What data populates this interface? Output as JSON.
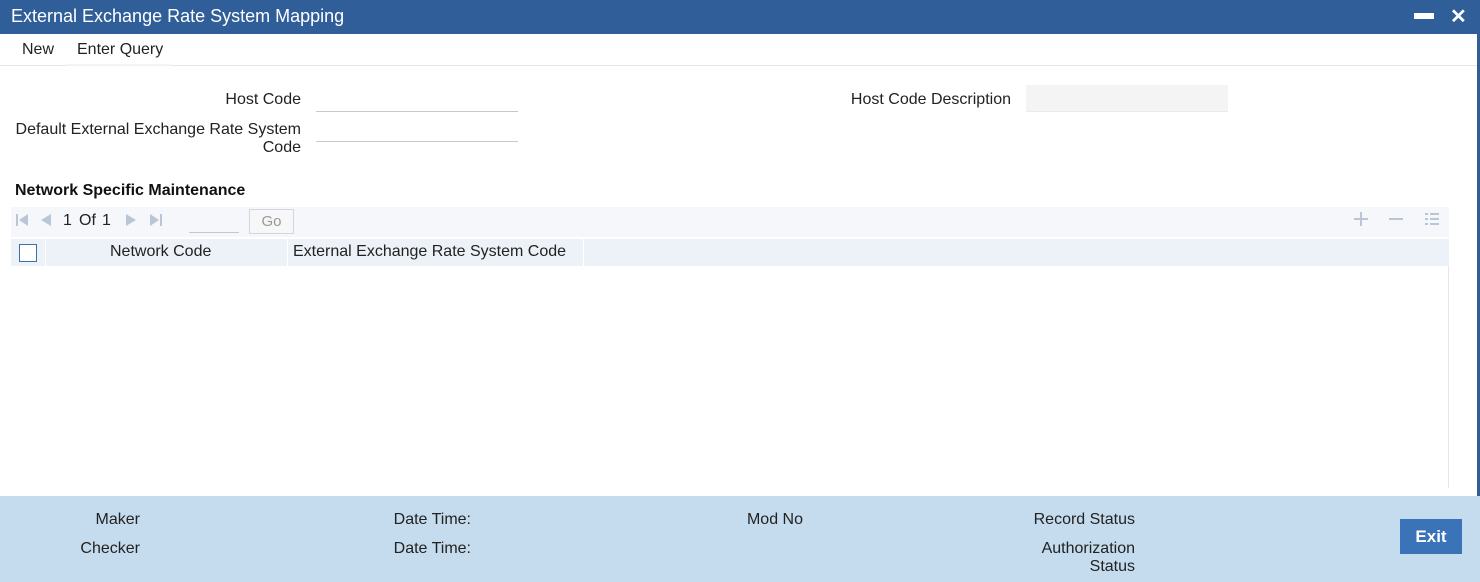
{
  "window": {
    "title": "External Exchange Rate System Mapping",
    "minimize": "▬",
    "close": "✕"
  },
  "menu": {
    "new": "New",
    "enter_query": "Enter Query"
  },
  "form": {
    "host_code_label": "Host Code",
    "host_code_value": "",
    "host_code_desc_label": "Host Code Description",
    "host_code_desc_value": "",
    "default_ext_label_line1": "Default External Exchange Rate System",
    "default_ext_label_line2": "Code",
    "default_ext_value": ""
  },
  "section": {
    "title": "Network Specific Maintenance"
  },
  "pager": {
    "current": "1",
    "of": "Of",
    "total": "1",
    "go": "Go",
    "page_input": ""
  },
  "grid": {
    "columns": [
      "Network Code",
      "External Exchange Rate System Code"
    ],
    "rows": []
  },
  "footer": {
    "maker": "Maker",
    "checker": "Checker",
    "date_time_1": "Date Time:",
    "date_time_2": "Date Time:",
    "mod_no": "Mod No",
    "record_status": "Record Status",
    "auth_status_line1": "Authorization",
    "auth_status_line2": "Status",
    "exit": "Exit"
  },
  "icons": {
    "first": "first-page-icon",
    "prev": "previous-page-icon",
    "next": "next-page-icon",
    "last": "last-page-icon",
    "add": "add-row-icon",
    "delete": "delete-row-icon",
    "single_view": "single-record-view-icon"
  },
  "colors": {
    "titlebar": "#2f5e99",
    "footer": "#c5dcee",
    "exit_button": "#3b73b9"
  }
}
